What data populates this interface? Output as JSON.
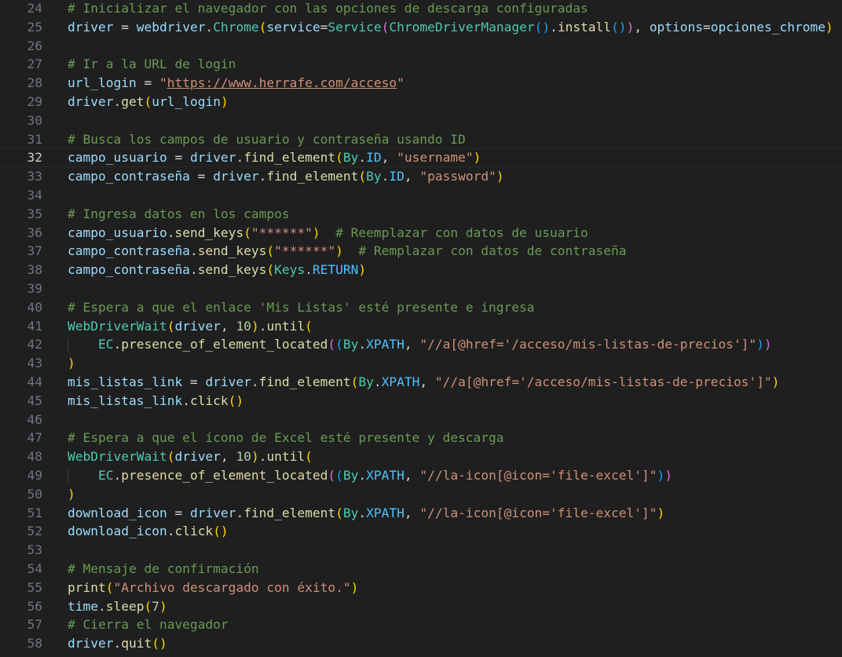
{
  "editor": {
    "current_line": 32,
    "lines": [
      {
        "n": "24",
        "t": [
          [
            "# Inicializar el navegador con las opciones de descarga configuradas",
            "t-com"
          ]
        ]
      },
      {
        "n": "25",
        "t": [
          [
            "driver",
            "t-var"
          ],
          [
            " = ",
            "t-op"
          ],
          [
            "webdriver",
            "t-var"
          ],
          [
            ".",
            "t-op"
          ],
          [
            "Chrome",
            "t-cls"
          ],
          [
            "(",
            "t-b1"
          ],
          [
            "service",
            "t-var"
          ],
          [
            "=",
            "t-op"
          ],
          [
            "Service",
            "t-cls"
          ],
          [
            "(",
            "t-b2"
          ],
          [
            "ChromeDriverManager",
            "t-cls"
          ],
          [
            "()",
            "t-b3"
          ],
          [
            ".",
            "t-op"
          ],
          [
            "install",
            "t-fn"
          ],
          [
            "()",
            "t-b3"
          ],
          [
            ")",
            "t-b2"
          ],
          [
            ", ",
            "t-op"
          ],
          [
            "options",
            "t-var"
          ],
          [
            "=",
            "t-op"
          ],
          [
            "opciones_chrome",
            "t-var"
          ],
          [
            ")",
            "t-b1"
          ]
        ]
      },
      {
        "n": "26",
        "t": []
      },
      {
        "n": "27",
        "t": [
          [
            "# Ir a la URL de login",
            "t-com"
          ]
        ]
      },
      {
        "n": "28",
        "t": [
          [
            "url_login",
            "t-var"
          ],
          [
            " = ",
            "t-op"
          ],
          [
            "\"",
            "t-str"
          ],
          [
            "https://www.herrafe.com/acceso",
            "t-url"
          ],
          [
            "\"",
            "t-str"
          ]
        ]
      },
      {
        "n": "29",
        "t": [
          [
            "driver",
            "t-var"
          ],
          [
            ".",
            "t-op"
          ],
          [
            "get",
            "t-fn"
          ],
          [
            "(",
            "t-b1"
          ],
          [
            "url_login",
            "t-var"
          ],
          [
            ")",
            "t-b1"
          ]
        ]
      },
      {
        "n": "30",
        "t": []
      },
      {
        "n": "31",
        "t": [
          [
            "# Busca los campos de usuario y contraseña usando ID",
            "t-com"
          ]
        ]
      },
      {
        "n": "32",
        "t": [
          [
            "campo_usuario",
            "t-var"
          ],
          [
            " = ",
            "t-op"
          ],
          [
            "driver",
            "t-var"
          ],
          [
            ".",
            "t-op"
          ],
          [
            "find_element",
            "t-fn"
          ],
          [
            "(",
            "t-b1"
          ],
          [
            "By",
            "t-cls"
          ],
          [
            ".",
            "t-op"
          ],
          [
            "ID",
            "t-const"
          ],
          [
            ", ",
            "t-op"
          ],
          [
            "\"username\"",
            "t-str"
          ],
          [
            ")",
            "t-b1"
          ]
        ]
      },
      {
        "n": "33",
        "t": [
          [
            "campo_contraseña",
            "t-var"
          ],
          [
            " = ",
            "t-op"
          ],
          [
            "driver",
            "t-var"
          ],
          [
            ".",
            "t-op"
          ],
          [
            "find_element",
            "t-fn"
          ],
          [
            "(",
            "t-b1"
          ],
          [
            "By",
            "t-cls"
          ],
          [
            ".",
            "t-op"
          ],
          [
            "ID",
            "t-const"
          ],
          [
            ", ",
            "t-op"
          ],
          [
            "\"password\"",
            "t-str"
          ],
          [
            ")",
            "t-b1"
          ]
        ]
      },
      {
        "n": "34",
        "t": []
      },
      {
        "n": "35",
        "t": [
          [
            "# Ingresa datos en los campos",
            "t-com"
          ]
        ]
      },
      {
        "n": "36",
        "t": [
          [
            "campo_usuario",
            "t-var"
          ],
          [
            ".",
            "t-op"
          ],
          [
            "send_keys",
            "t-fn"
          ],
          [
            "(",
            "t-b1"
          ],
          [
            "\"******\"",
            "t-str"
          ],
          [
            ")",
            "t-b1"
          ],
          [
            "  ",
            "t-op"
          ],
          [
            "# Reemplazar con datos de usuario",
            "t-com"
          ]
        ]
      },
      {
        "n": "37",
        "t": [
          [
            "campo_contraseña",
            "t-var"
          ],
          [
            ".",
            "t-op"
          ],
          [
            "send_keys",
            "t-fn"
          ],
          [
            "(",
            "t-b1"
          ],
          [
            "\"******\"",
            "t-str"
          ],
          [
            ")",
            "t-b1"
          ],
          [
            "  ",
            "t-op"
          ],
          [
            "# Remplazar con datos de contraseña",
            "t-com"
          ]
        ]
      },
      {
        "n": "38",
        "t": [
          [
            "campo_contraseña",
            "t-var"
          ],
          [
            ".",
            "t-op"
          ],
          [
            "send_keys",
            "t-fn"
          ],
          [
            "(",
            "t-b1"
          ],
          [
            "Keys",
            "t-cls"
          ],
          [
            ".",
            "t-op"
          ],
          [
            "RETURN",
            "t-const"
          ],
          [
            ")",
            "t-b1"
          ]
        ]
      },
      {
        "n": "39",
        "t": []
      },
      {
        "n": "40",
        "t": [
          [
            "# Espera a que el enlace 'Mis Listas' esté presente e ingresa",
            "t-com"
          ]
        ]
      },
      {
        "n": "41",
        "t": [
          [
            "WebDriverWait",
            "t-cls"
          ],
          [
            "(",
            "t-b1"
          ],
          [
            "driver",
            "t-var"
          ],
          [
            ", ",
            "t-op"
          ],
          [
            "10",
            "t-num"
          ],
          [
            ")",
            "t-b1"
          ],
          [
            ".",
            "t-op"
          ],
          [
            "until",
            "t-fn"
          ],
          [
            "(",
            "t-b1"
          ]
        ]
      },
      {
        "n": "42",
        "indent": true,
        "t": [
          [
            "    ",
            "t-op"
          ],
          [
            "EC",
            "t-cls"
          ],
          [
            ".",
            "t-op"
          ],
          [
            "presence_of_element_located",
            "t-fn"
          ],
          [
            "(",
            "t-b2"
          ],
          [
            "(",
            "t-b3"
          ],
          [
            "By",
            "t-cls"
          ],
          [
            ".",
            "t-op"
          ],
          [
            "XPATH",
            "t-const"
          ],
          [
            ", ",
            "t-op"
          ],
          [
            "\"//a[@href='/acceso/mis-listas-de-precios']\"",
            "t-str"
          ],
          [
            ")",
            "t-b3"
          ],
          [
            ")",
            "t-b2"
          ]
        ]
      },
      {
        "n": "43",
        "t": [
          [
            ")",
            "t-b1"
          ]
        ]
      },
      {
        "n": "44",
        "t": [
          [
            "mis_listas_link",
            "t-var"
          ],
          [
            " = ",
            "t-op"
          ],
          [
            "driver",
            "t-var"
          ],
          [
            ".",
            "t-op"
          ],
          [
            "find_element",
            "t-fn"
          ],
          [
            "(",
            "t-b1"
          ],
          [
            "By",
            "t-cls"
          ],
          [
            ".",
            "t-op"
          ],
          [
            "XPATH",
            "t-const"
          ],
          [
            ", ",
            "t-op"
          ],
          [
            "\"//a[@href='/acceso/mis-listas-de-precios']\"",
            "t-str"
          ],
          [
            ")",
            "t-b1"
          ]
        ]
      },
      {
        "n": "45",
        "t": [
          [
            "mis_listas_link",
            "t-var"
          ],
          [
            ".",
            "t-op"
          ],
          [
            "click",
            "t-fn"
          ],
          [
            "()",
            "t-b1"
          ]
        ]
      },
      {
        "n": "46",
        "t": []
      },
      {
        "n": "47",
        "t": [
          [
            "# Espera a que el ícono de Excel esté presente y descarga",
            "t-com"
          ]
        ]
      },
      {
        "n": "48",
        "t": [
          [
            "WebDriverWait",
            "t-cls"
          ],
          [
            "(",
            "t-b1"
          ],
          [
            "driver",
            "t-var"
          ],
          [
            ", ",
            "t-op"
          ],
          [
            "10",
            "t-num"
          ],
          [
            ")",
            "t-b1"
          ],
          [
            ".",
            "t-op"
          ],
          [
            "until",
            "t-fn"
          ],
          [
            "(",
            "t-b1"
          ]
        ]
      },
      {
        "n": "49",
        "indent": true,
        "t": [
          [
            "    ",
            "t-op"
          ],
          [
            "EC",
            "t-cls"
          ],
          [
            ".",
            "t-op"
          ],
          [
            "presence_of_element_located",
            "t-fn"
          ],
          [
            "(",
            "t-b2"
          ],
          [
            "(",
            "t-b3"
          ],
          [
            "By",
            "t-cls"
          ],
          [
            ".",
            "t-op"
          ],
          [
            "XPATH",
            "t-const"
          ],
          [
            ", ",
            "t-op"
          ],
          [
            "\"//la-icon[@icon='file-excel']\"",
            "t-str"
          ],
          [
            ")",
            "t-b3"
          ],
          [
            ")",
            "t-b2"
          ]
        ]
      },
      {
        "n": "50",
        "t": [
          [
            ")",
            "t-b1"
          ]
        ]
      },
      {
        "n": "51",
        "t": [
          [
            "download_icon",
            "t-var"
          ],
          [
            " = ",
            "t-op"
          ],
          [
            "driver",
            "t-var"
          ],
          [
            ".",
            "t-op"
          ],
          [
            "find_element",
            "t-fn"
          ],
          [
            "(",
            "t-b1"
          ],
          [
            "By",
            "t-cls"
          ],
          [
            ".",
            "t-op"
          ],
          [
            "XPATH",
            "t-const"
          ],
          [
            ", ",
            "t-op"
          ],
          [
            "\"//la-icon[@icon='file-excel']\"",
            "t-str"
          ],
          [
            ")",
            "t-b1"
          ]
        ]
      },
      {
        "n": "52",
        "t": [
          [
            "download_icon",
            "t-var"
          ],
          [
            ".",
            "t-op"
          ],
          [
            "click",
            "t-fn"
          ],
          [
            "()",
            "t-b1"
          ]
        ]
      },
      {
        "n": "53",
        "t": []
      },
      {
        "n": "54",
        "t": [
          [
            "# Mensaje de confirmación",
            "t-com"
          ]
        ]
      },
      {
        "n": "55",
        "t": [
          [
            "print",
            "t-fn"
          ],
          [
            "(",
            "t-b1"
          ],
          [
            "\"Archivo descargado con éxito.\"",
            "t-str"
          ],
          [
            ")",
            "t-b1"
          ]
        ]
      },
      {
        "n": "56",
        "t": [
          [
            "time",
            "t-var"
          ],
          [
            ".",
            "t-op"
          ],
          [
            "sleep",
            "t-fn"
          ],
          [
            "(",
            "t-b1"
          ],
          [
            "7",
            "t-num"
          ],
          [
            ")",
            "t-b1"
          ]
        ]
      },
      {
        "n": "57",
        "t": [
          [
            "# Cierra el navegador",
            "t-com"
          ]
        ]
      },
      {
        "n": "58",
        "t": [
          [
            "driver",
            "t-var"
          ],
          [
            ".",
            "t-op"
          ],
          [
            "quit",
            "t-fn"
          ],
          [
            "()",
            "t-b1"
          ]
        ]
      }
    ]
  }
}
